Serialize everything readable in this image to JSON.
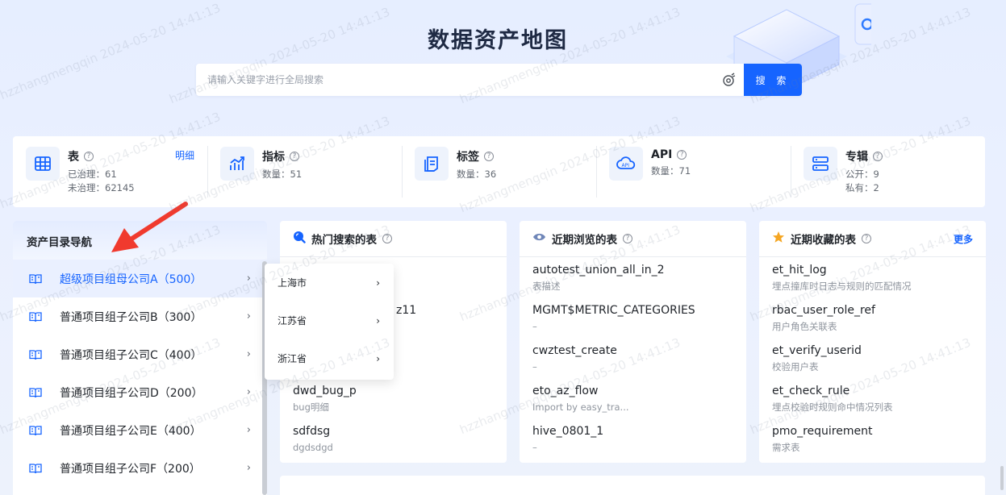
{
  "page": {
    "title": "数据资产地图"
  },
  "search": {
    "placeholder": "请输入关键字进行全局搜索",
    "button_label": "搜 索"
  },
  "stats": [
    {
      "title": "表",
      "icon": "table-icon",
      "link": "明细",
      "lines": [
        "已治理：61",
        "未治理：62145"
      ]
    },
    {
      "title": "指标",
      "icon": "metric-chart-icon",
      "lines": [
        "数量：51"
      ]
    },
    {
      "title": "标签",
      "icon": "tag-doc-icon",
      "lines": [
        "数量：36"
      ]
    },
    {
      "title": "API",
      "icon": "api-cloud-icon",
      "lines": [
        "数量：71"
      ]
    },
    {
      "title": "专辑",
      "icon": "album-icon",
      "lines": [
        "公开：9",
        "私有：2"
      ]
    }
  ],
  "nav": {
    "title": "资产目录导航",
    "items": [
      {
        "label": "超级项目组母公司A（500）",
        "active": true
      },
      {
        "label": "普通项目组子公司B（300）"
      },
      {
        "label": "普通项目组子公司C（400）"
      },
      {
        "label": "普通项目组子公司D（200）"
      },
      {
        "label": "普通项目组子公司E（400）"
      },
      {
        "label": "普通项目组子公司F（200）"
      }
    ]
  },
  "popover": {
    "items": [
      "上海市",
      "江苏省",
      "浙江省"
    ]
  },
  "hot_tables": {
    "title": "热门搜索的表",
    "rows": [
      {
        "name": "",
        "desc": ""
      },
      {
        "name": "z11",
        "desc": ""
      },
      {
        "name": "",
        "desc": ""
      },
      {
        "name": "dwd_bug_p",
        "desc": "bug明细"
      },
      {
        "name": "sdfdsg",
        "desc": "dgdsdgd"
      }
    ]
  },
  "recent_tables": {
    "title": "近期浏览的表",
    "rows": [
      {
        "name": "autotest_union_all_in_2",
        "desc": "表描述"
      },
      {
        "name": "MGMT$METRIC_CATEGORIES",
        "desc": "–"
      },
      {
        "name": "cwztest_create",
        "desc": "–"
      },
      {
        "name": "eto_az_flow",
        "desc": "Import by easy_tra..."
      },
      {
        "name": "hive_0801_1",
        "desc": "–"
      }
    ]
  },
  "favorite_tables": {
    "title": "近期收藏的表",
    "more": "更多",
    "rows": [
      {
        "name": "et_hit_log",
        "desc": "埋点撞库时日志与规则的匹配情况"
      },
      {
        "name": "rbac_user_role_ref",
        "desc": "用户角色关联表"
      },
      {
        "name": "et_verify_userid",
        "desc": "校验用户表"
      },
      {
        "name": "et_check_rule",
        "desc": "埋点校验时规则命中情况列表"
      },
      {
        "name": "pmo_requirement",
        "desc": "需求表"
      }
    ]
  },
  "watermark": {
    "text": "hzzhangmengqin 2024-05-20 14:41:13"
  },
  "colors": {
    "accent": "#1664ff",
    "background": "#e9efff"
  }
}
